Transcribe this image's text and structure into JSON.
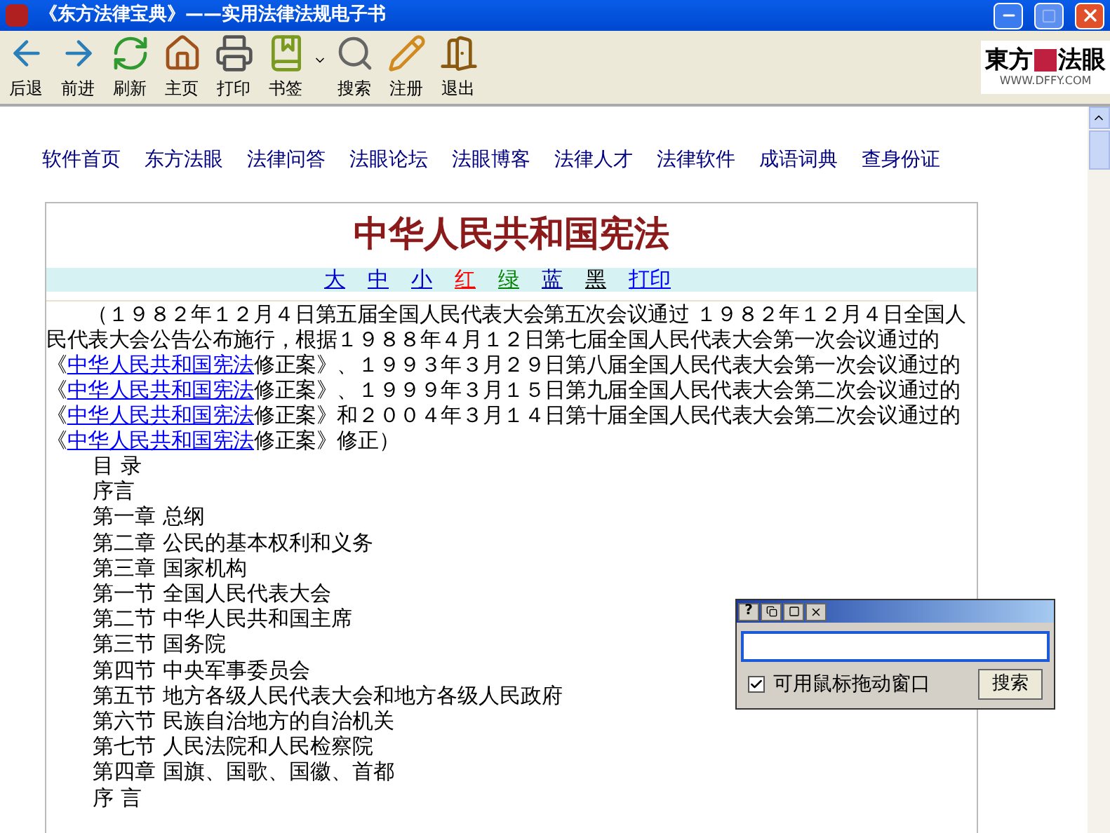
{
  "window": {
    "title": "《东方法律宝典》——实用法律法规电子书",
    "maximize_disabled": true
  },
  "toolbar": [
    {
      "label": "后退",
      "kind": "back"
    },
    {
      "label": "前进",
      "kind": "forward"
    },
    {
      "label": "刷新",
      "kind": "refresh"
    },
    {
      "label": "主页",
      "kind": "home"
    },
    {
      "label": "打印",
      "kind": "print"
    },
    {
      "label": "书签",
      "kind": "bookmark"
    },
    {
      "label": "搜索",
      "kind": "search"
    },
    {
      "label": "注册",
      "kind": "register"
    },
    {
      "label": "退出",
      "kind": "exit"
    }
  ],
  "logo": {
    "name": "東方",
    "name2": "法眼",
    "url": "WWW.DFFY.COM"
  },
  "nav_links": [
    "软件首页",
    "东方法眼",
    "法律问答",
    "法眼论坛",
    "法眼博客",
    "法律人才",
    "法律软件",
    "成语词典",
    "查身份证"
  ],
  "document": {
    "title": "中华人民共和国宪法",
    "options": [
      {
        "label": "大",
        "color": "#0000cc"
      },
      {
        "label": "中",
        "color": "#0000cc"
      },
      {
        "label": "小",
        "color": "#0000cc"
      },
      {
        "label": "红",
        "color": "#ff0000"
      },
      {
        "label": "绿",
        "color": "#008000"
      },
      {
        "label": "蓝",
        "color": "#000099"
      },
      {
        "label": "黑",
        "color": "#000000"
      },
      {
        "label": "打印",
        "color": "#0000ff"
      }
    ],
    "preamble": [
      {
        "text": "（１９８２年１２月４日第五届全国人民代表大会第五次会议通过 １９８２年１２月４日全国人民代表大会公告公布施行，根据１９８８年４月１２日第七届全国人民代表大会第一次会议通过的《",
        "link": false
      },
      {
        "text": "中华人民共和国宪法",
        "link": true
      },
      {
        "text": "修正案》、１９９３年３月２９日第八届全国人民代表大会第一次会议通过的《",
        "link": false
      },
      {
        "text": "中华人民共和国宪法",
        "link": true
      },
      {
        "text": "修正案》、１９９９年３月１５日第九届全国人民代表大会第二次会议通过的《",
        "link": false
      },
      {
        "text": "中华人民共和国宪法",
        "link": true
      },
      {
        "text": "修正案》和２００４年３月１４日第十届全国人民代表大会第二次会议通过的《",
        "link": false
      },
      {
        "text": "中华人民共和国宪法",
        "link": true
      },
      {
        "text": "修正案》修正）",
        "link": false
      }
    ],
    "contents": [
      "目 录",
      "序言",
      "第一章 总纲",
      "第二章 公民的基本权利和义务",
      "第三章 国家机构",
      "第一节 全国人民代表大会",
      "第二节 中华人民共和国主席",
      "第三节 国务院",
      "第四节 中央军事委员会",
      "第五节 地方各级人民代表大会和地方各级人民政府",
      "第六节 民族自治地方的自治机关",
      "第七节 人民法院和人民检察院",
      "第四章 国旗、国歌、国徽、首都",
      "序 言"
    ]
  },
  "search_window": {
    "help": "?",
    "drag_checkbox": {
      "label": "可用鼠标拖动窗口",
      "checked": true
    },
    "button": "搜索"
  }
}
